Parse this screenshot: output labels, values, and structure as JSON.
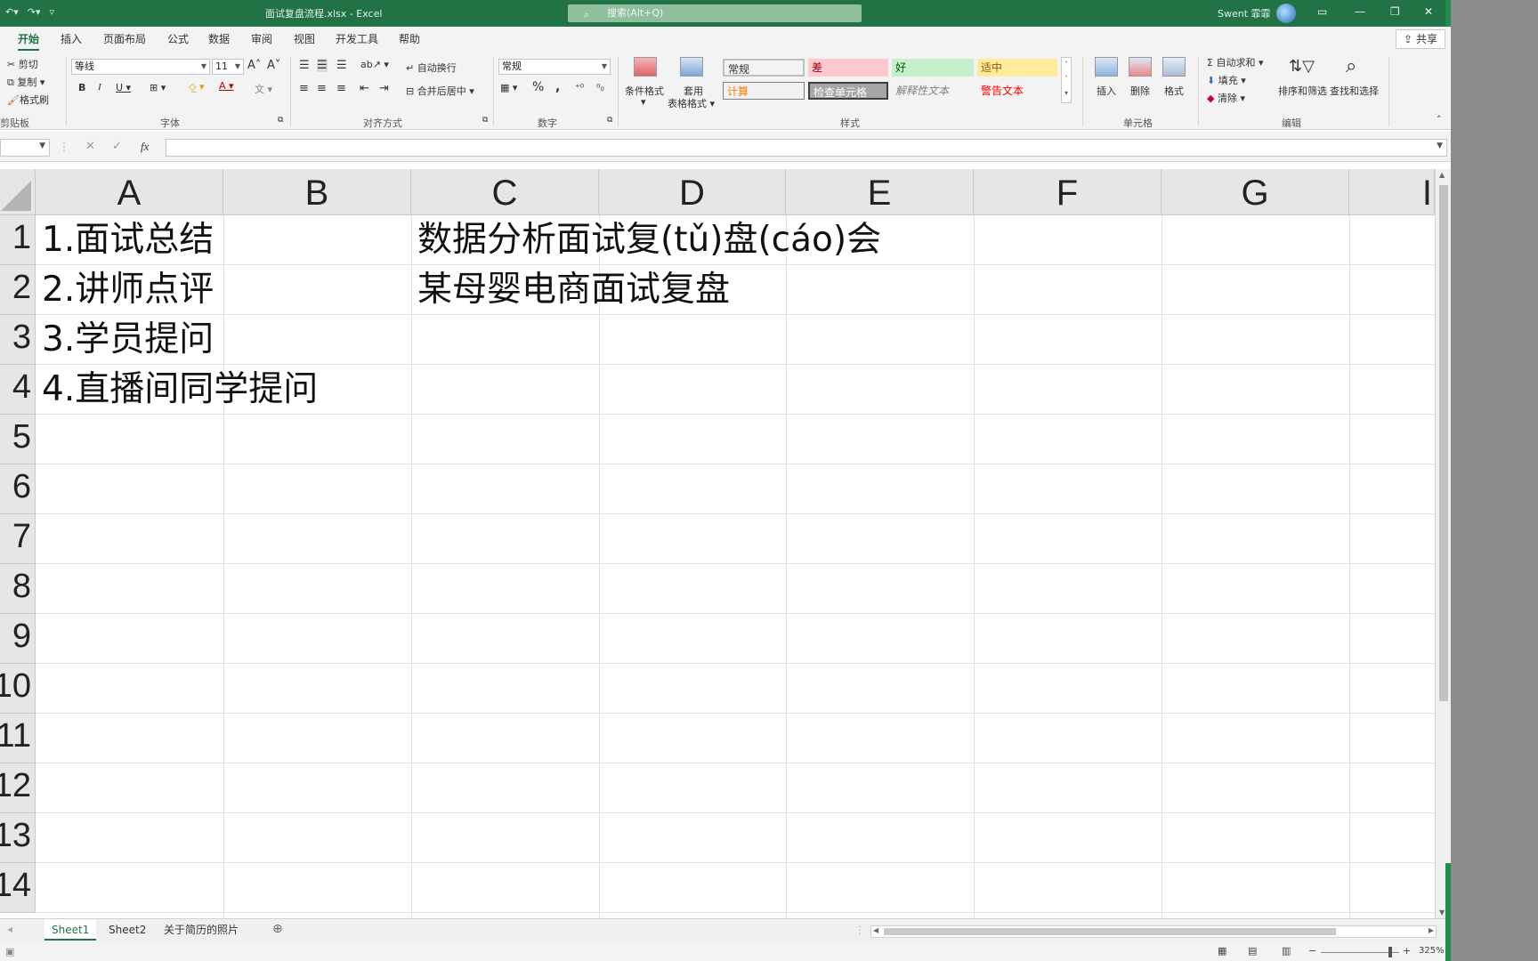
{
  "window": {
    "filename": "面试复盘流程.xlsx",
    "app": "Excel",
    "search_placeholder": "搜索(Alt+Q)",
    "user": "Swent 霏霏"
  },
  "tabs": [
    "开始",
    "插入",
    "页面布局",
    "公式",
    "数据",
    "审阅",
    "视图",
    "开发工具",
    "帮助"
  ],
  "active_tab": "开始",
  "share_label": "共享",
  "ribbon": {
    "clipboard": {
      "cut": "剪切",
      "copy": "复制",
      "painter": "格式刷",
      "label": "剪贴板"
    },
    "font": {
      "name": "等线",
      "size": "11",
      "label": "字体"
    },
    "alignment": {
      "wrap": "自动换行",
      "merge": "合并后居中",
      "label": "对齐方式"
    },
    "number": {
      "format": "常规",
      "label": "数字"
    },
    "styles": {
      "conditional": "条件格式",
      "table_line1": "套用",
      "table_line2": "表格格式",
      "cells": [
        {
          "text": "常规",
          "bg": "#ffffff",
          "color": "#111111"
        },
        {
          "text": "差",
          "bg": "#ffc7ce",
          "color": "#9c0006"
        },
        {
          "text": "好",
          "bg": "#c6efce",
          "color": "#006100"
        },
        {
          "text": "适中",
          "bg": "#ffeb9c",
          "color": "#9c5700"
        },
        {
          "text": "计算",
          "bg": "#f2f2f2",
          "color": "#fa7d00"
        },
        {
          "text": "检查单元格",
          "bg": "#a5a5a5",
          "color": "#ffffff"
        },
        {
          "text": "解释性文本",
          "bg": "#f3f3f3",
          "color": "#7f7f7f"
        },
        {
          "text": "警告文本",
          "bg": "#f3f3f3",
          "color": "#ff0000"
        }
      ],
      "label": "样式"
    },
    "cells_group": {
      "insert": "插入",
      "delete": "删除",
      "format": "格式",
      "label": "单元格"
    },
    "editing": {
      "autosum": "自动求和",
      "fill": "填充",
      "clear": "清除",
      "sort": "排序和筛选",
      "find": "查找和选择",
      "label": "编辑"
    }
  },
  "formula_bar": {
    "fx": "fx",
    "content": ""
  },
  "columns": [
    "A",
    "B",
    "C",
    "D",
    "E",
    "F",
    "G",
    "I"
  ],
  "rows": [
    "1",
    "2",
    "3",
    "4",
    "5",
    "6",
    "7",
    "8",
    "9",
    "10",
    "11",
    "12",
    "13",
    "14"
  ],
  "cells": {
    "A1": "1.面试总结",
    "A2": "2.讲师点评",
    "A3": "3.学员提问",
    "A4": "4.直播间同学提问",
    "C1": "数据分析面试复(tǔ)盘(cáo)会",
    "C2": "某母婴电商面试复盘"
  },
  "sheets": [
    "Sheet1",
    "Sheet2",
    "关于简历的照片"
  ],
  "active_sheet": "Sheet1",
  "zoom": "325%"
}
